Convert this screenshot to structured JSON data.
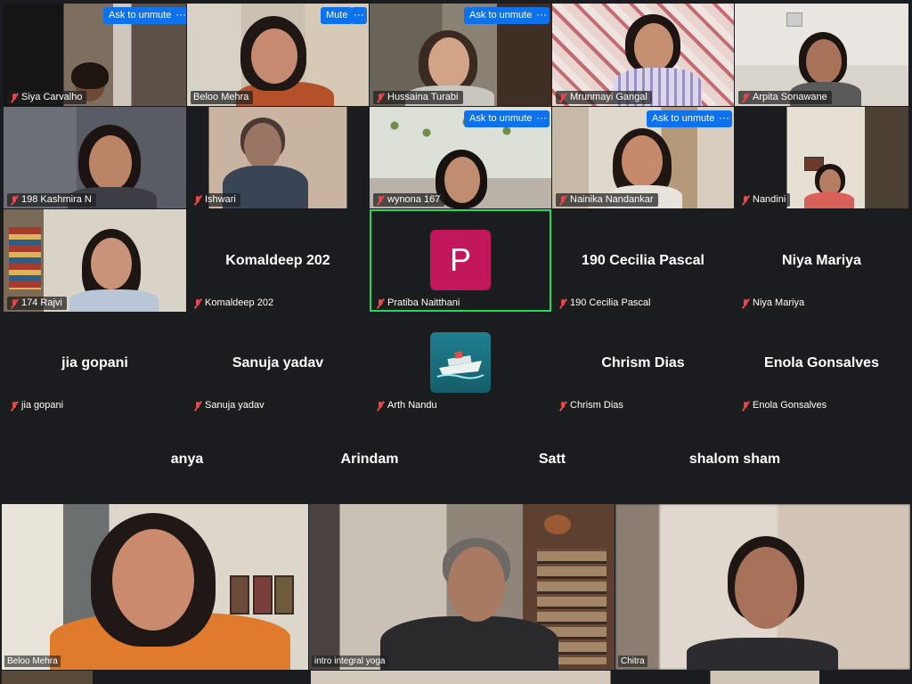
{
  "buttons": {
    "ask_to_unmute": "Ask to unmute",
    "mute": "Mute",
    "more": "···"
  },
  "row1": [
    {
      "name": "Siya Carvalho"
    },
    {
      "name": "Beloo Mehra"
    },
    {
      "name": "Hussaina Turabi"
    },
    {
      "name": "Mrunmayi Gangal"
    },
    {
      "name": "Arpita Sonawane"
    }
  ],
  "row2": [
    {
      "name": "198 Kashmira N"
    },
    {
      "name": "Ishwari"
    },
    {
      "name": "wynona 167"
    },
    {
      "name": "Nainika Nandankar"
    },
    {
      "name": "Nandini"
    }
  ],
  "row3": [
    {
      "name": "174 Rajvi"
    },
    {
      "name": "Komaldeep 202",
      "display": "Komaldeep 202"
    },
    {
      "name": "Pratiba Naitthani",
      "avatar_letter": "P"
    },
    {
      "name": "190 Cecilia Pascal",
      "display": "190 Cecilia Pascal"
    },
    {
      "name": "Niya Mariya",
      "display": "Niya Mariya"
    }
  ],
  "row4": [
    {
      "name": "jia gopani",
      "display": "jia gopani"
    },
    {
      "name": "Sanuja yadav",
      "display": "Sanuja yadav"
    },
    {
      "name": "Arth Nandu"
    },
    {
      "name": "Chrism Dias",
      "display": "Chrism Dias"
    },
    {
      "name": "Enola Gonsalves",
      "display": "Enola Gonsalves"
    }
  ],
  "row5": [
    {
      "display": "anya"
    },
    {
      "display": "Arindam"
    },
    {
      "display": "Satt"
    },
    {
      "display": "shalom sham"
    }
  ],
  "bottom": [
    {
      "name": "Beloo Mehra"
    },
    {
      "name": "intro integral yoga"
    },
    {
      "name": "Chitra"
    }
  ],
  "colors": {
    "accent": "#0e72ed",
    "active_speaker": "#23d959",
    "avatar_bg": "#c2185b",
    "muted": "#e5484d"
  }
}
